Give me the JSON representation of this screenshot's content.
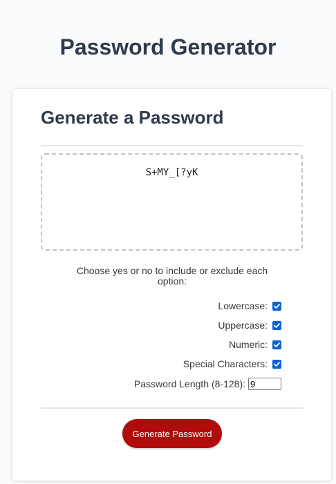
{
  "page": {
    "title": "Password Generator"
  },
  "card": {
    "header": "Generate a Password",
    "password": "S+MY_[?yK",
    "instructions": "Choose yes or no to include or exclude each option:",
    "options": [
      {
        "label": "Lowercase:",
        "checked": true
      },
      {
        "label": "Uppercase:",
        "checked": true
      },
      {
        "label": "Numeric:",
        "checked": true
      },
      {
        "label": "Special Characters:",
        "checked": true
      }
    ],
    "length": {
      "label": "Password Length (8-128):",
      "value": "9"
    },
    "generate_label": "Generate Password"
  },
  "colors": {
    "button": "#b00c0c",
    "checkbox": "#0b62d6",
    "title": "#2f3a4a"
  }
}
